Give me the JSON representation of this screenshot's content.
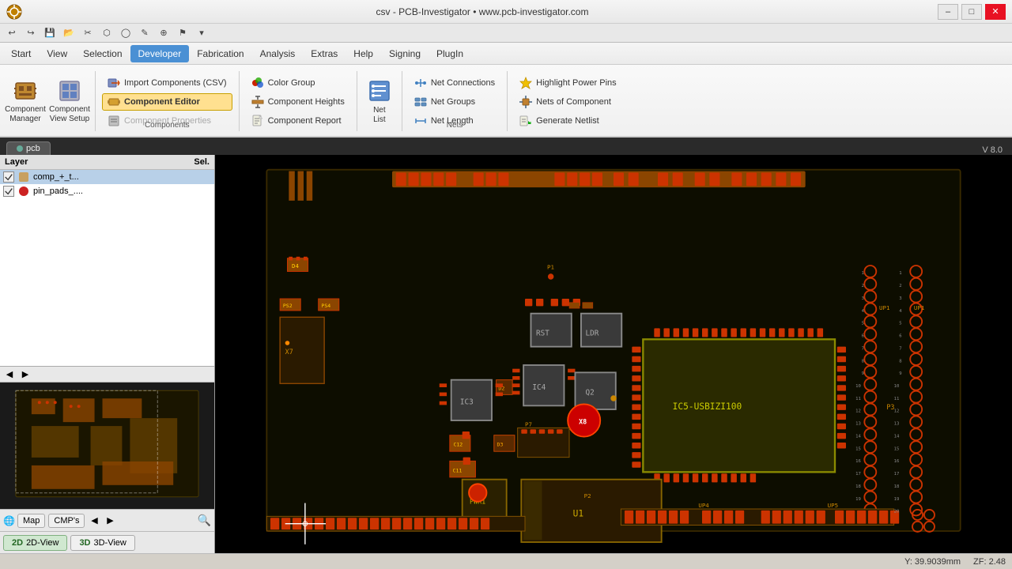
{
  "window": {
    "title": "csv - PCB-Investigator • www.pcb-investigator.com",
    "minimize": "–",
    "maximize": "□",
    "close": "✕"
  },
  "quick_access": {
    "buttons": [
      "↩",
      "↪",
      "💾",
      "📂",
      "✂",
      "📋",
      "📌",
      "⬟",
      "▸"
    ]
  },
  "menu": {
    "items": [
      "Start",
      "View",
      "Selection",
      "Developer",
      "Fabrication",
      "Analysis",
      "Extras",
      "Help",
      "Signing",
      "PlugIn"
    ],
    "active": "Developer"
  },
  "ribbon": {
    "components_group_label": "Components",
    "nets_group_label": "Nets",
    "buttons": {
      "component_manager": {
        "label": "Component\nManager",
        "active": false
      },
      "component_view_setup": {
        "label": "Component\nView Setup",
        "active": false
      },
      "import_components": "Import Components (CSV)",
      "component_editor": "Component Editor",
      "component_properties": "Component Properties",
      "color_group": "Color Group",
      "component_heights": "Component Heights",
      "component_report": "Component Report",
      "net_list": "Net\nList",
      "net_connections": "Net Connections",
      "net_groups": "Net Groups",
      "net_length": "Net Length",
      "highlight_power_pins": "Highlight Power Pins",
      "nets_of_component": "Nets of Component",
      "generate_netlist": "Generate Netlist"
    }
  },
  "tab": {
    "name": "pcb",
    "version": "V 8.0"
  },
  "layers": {
    "header": "Layer",
    "sel_header": "Sel.",
    "items": [
      {
        "name": "comp_+_t...",
        "color": "#c8a060",
        "checked": true,
        "selected": true
      },
      {
        "name": "pin_pads_....",
        "color": "#cc2222",
        "checked": true,
        "selected": false
      }
    ]
  },
  "map_controls": {
    "map_label": "Map",
    "cmps_label": "CMP's",
    "nav_left": "◀",
    "nav_right": "▶",
    "globe_icon": "🌐",
    "search_icon": "🔍"
  },
  "view_toggle": {
    "btn_2d": "2D-View",
    "btn_3d": "3D-View"
  },
  "statusbar": {
    "coordinates": "Y: 39.9039mm",
    "zoom": "ZF: 2.48"
  },
  "pcb": {
    "bg_color": "#000000",
    "board_color": "#1a1a00",
    "copper_color": "#8b4500",
    "pad_color": "#cc2200",
    "highlight_color": "#ff4400"
  }
}
